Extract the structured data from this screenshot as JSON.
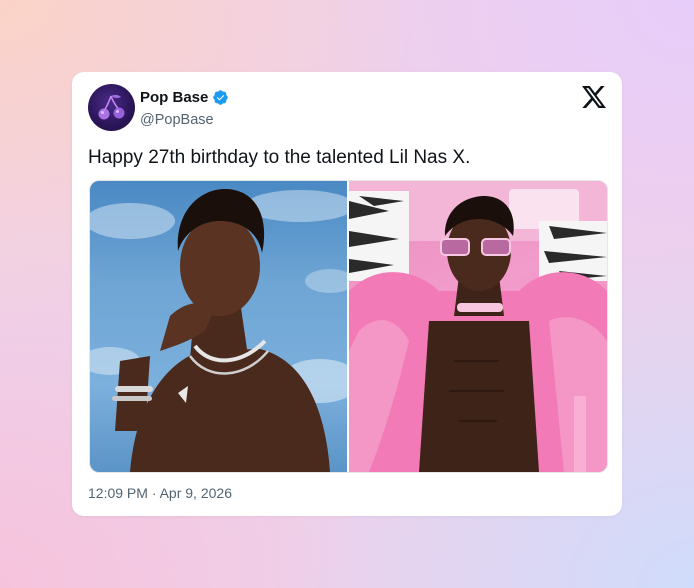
{
  "tweet": {
    "display_name": "Pop Base",
    "handle": "@PopBase",
    "verified": true,
    "text": "Happy 27th birthday to the talented Lil Nas X.",
    "timestamp": "12:09 PM · Apr 9, 2026",
    "media": [
      {
        "description_icon": "photo-portrait-sky"
      },
      {
        "description_icon": "photo-portrait-pink-fur"
      }
    ]
  },
  "icons": {
    "verified": "verified-badge-icon",
    "platform": "x-logo-icon"
  },
  "colors": {
    "verified_blue": "#1d9bf0",
    "text_primary": "#0f1419",
    "text_secondary": "#536471",
    "card_bg": "#ffffff"
  }
}
